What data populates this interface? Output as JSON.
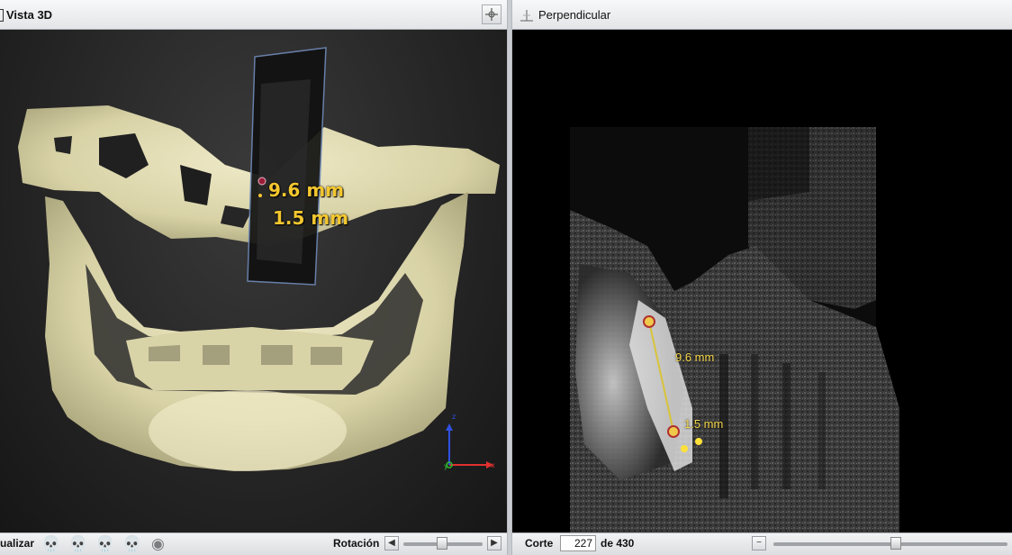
{
  "left_panel": {
    "title": "Vista 3D",
    "measurement_long": "9.6 mm",
    "measurement_short": "1.5 mm",
    "bottom": {
      "visualize_label": "ualizar",
      "rotation_label": "Rotación",
      "preset_icons": [
        "skull-front-icon",
        "skull-side-icon",
        "skull-side-icon",
        "skull-top-icon",
        "skull-bone-icon"
      ],
      "rotation_left_icon": "arrow-left-icon",
      "rotation_right_icon": "arrow-right-icon",
      "rotation_value": 0.5
    },
    "axes_colors": {
      "x": "#e03030",
      "y": "#30c030",
      "z": "#3050e0"
    }
  },
  "right_panel": {
    "title": "Perpendicular",
    "measurement_long": "9.6 mm",
    "measurement_short": "1.5 mm",
    "bottom": {
      "slice_label": "Corte",
      "slice_value": "227",
      "slice_of": "de 430",
      "minus_icon": "minus-icon",
      "slice_position": 0.528
    }
  },
  "accent_color": "#f4c72f"
}
